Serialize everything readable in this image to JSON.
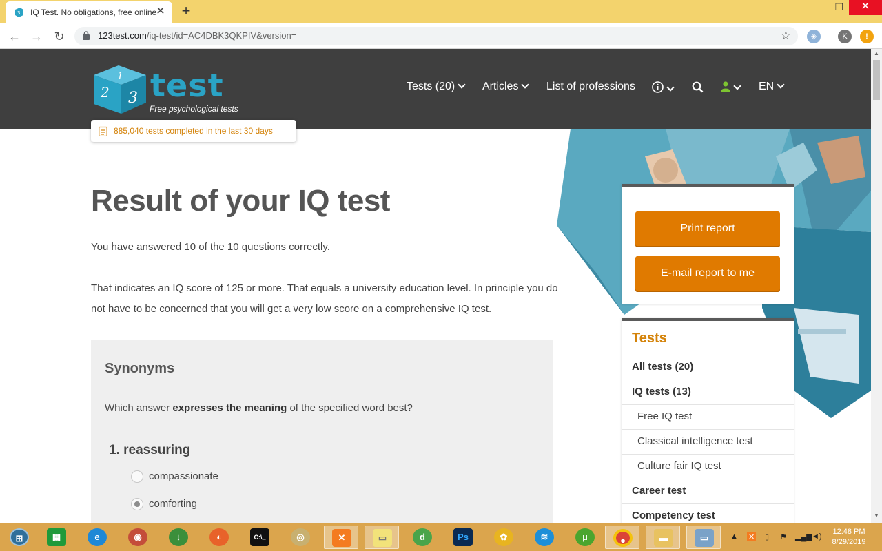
{
  "browser": {
    "tab_title": "IQ Test. No obligations, free online",
    "url_host": "123test.com",
    "url_path": "/iq-test/id=AC4DBK3QKPIV&version=",
    "profile_initial": "K"
  },
  "header": {
    "logo_word": "test",
    "logo_tagline": "Free psychological tests",
    "nav": {
      "tests": "Tests (20)",
      "articles": "Articles",
      "professions": "List of professions",
      "language": "EN"
    },
    "counter": "885,040 tests completed in the last 30 days"
  },
  "main": {
    "title": "Result of your IQ test",
    "answered": "You have answered 10 of the 10 questions correctly.",
    "score_line1": "That indicates an IQ score of 125 or more. That equals a university education level. In principle you do",
    "score_line2": "not have to be concerned that you will get a very low score on a comprehensive IQ test."
  },
  "quiz": {
    "section": "Synonyms",
    "prompt_pre": "Which answer ",
    "prompt_bold": "expresses the meaning",
    "prompt_post": " of the specified word best?",
    "question": "1. reassuring",
    "options": [
      {
        "label": "compassionate",
        "selected": false
      },
      {
        "label": "comforting",
        "selected": true
      }
    ]
  },
  "sidebar": {
    "print_button": "Print report",
    "email_button": "E-mail report to me",
    "tests_heading": "Tests",
    "tests": [
      {
        "label": "All tests (20)",
        "level": "main"
      },
      {
        "label": "IQ tests (13)",
        "level": "main"
      },
      {
        "label": "Free IQ test",
        "level": "sub"
      },
      {
        "label": "Classical intelligence test",
        "level": "sub"
      },
      {
        "label": "Culture fair IQ test",
        "level": "sub"
      },
      {
        "label": "Career test",
        "level": "main"
      },
      {
        "label": "Competency test",
        "level": "main"
      }
    ]
  },
  "taskbar": {
    "time": "12:48 PM",
    "date": "8/29/2019"
  },
  "colors": {
    "accent_orange": "#e07a00",
    "header_bg": "#3f3f3f",
    "logo_blue": "#2aa3c5",
    "titlebar": "#f3d36d"
  }
}
